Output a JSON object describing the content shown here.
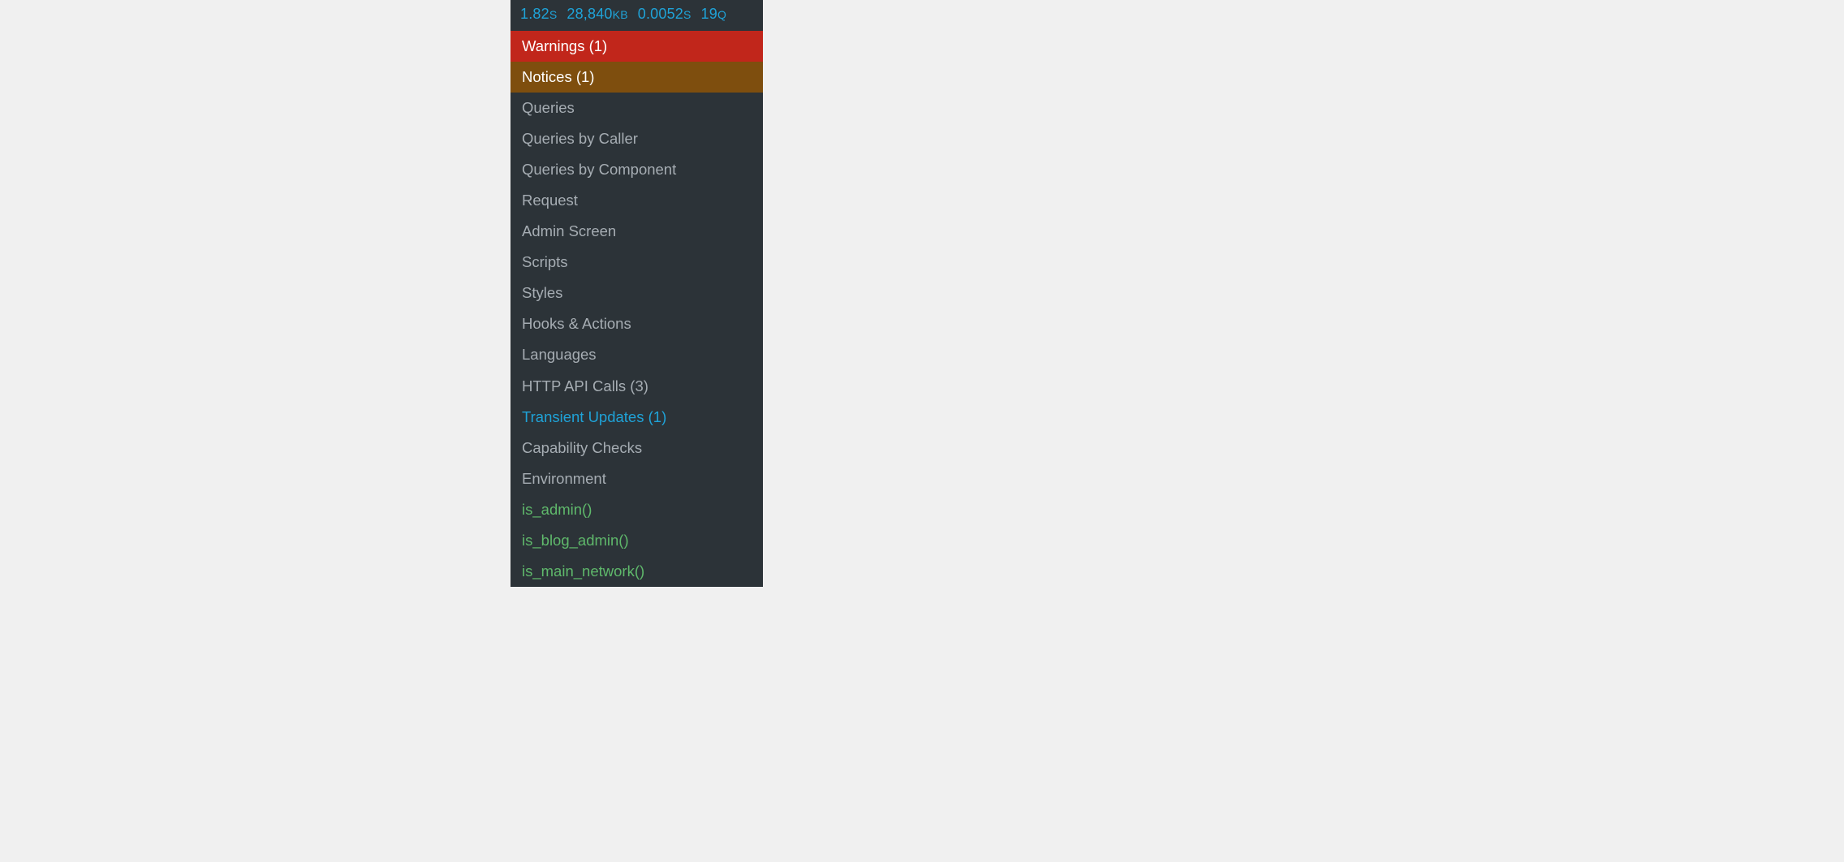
{
  "stats": {
    "time": {
      "value": "1.82",
      "unit": "S"
    },
    "memory": {
      "value": "28,840",
      "unit": "KB"
    },
    "dbtime": {
      "value": "0.0052",
      "unit": "S"
    },
    "queries": {
      "value": "19",
      "unit": "Q"
    }
  },
  "menu": {
    "warnings": "Warnings (1)",
    "notices": "Notices (1)",
    "queries": "Queries",
    "queries_by_caller": "Queries by Caller",
    "queries_by_component": "Queries by Component",
    "request": "Request",
    "admin_screen": "Admin Screen",
    "scripts": "Scripts",
    "styles": "Styles",
    "hooks": "Hooks & Actions",
    "languages": "Languages",
    "http_api": "HTTP API Calls (3)",
    "transient": "Transient Updates (1)",
    "capability": "Capability Checks",
    "environment": "Environment",
    "is_admin": "is_admin()",
    "is_blog_admin": "is_blog_admin()",
    "is_main_network": "is_main_network()"
  }
}
